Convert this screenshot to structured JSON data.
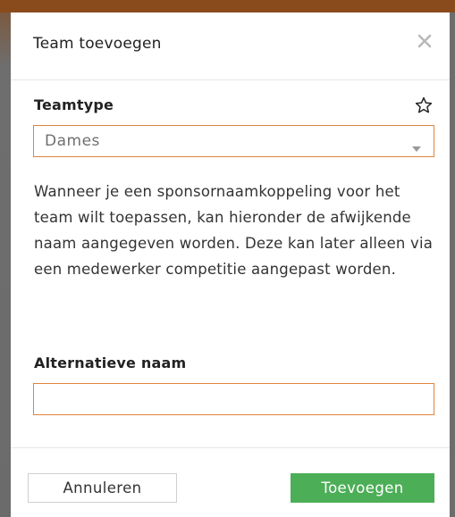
{
  "dialog": {
    "title": "Team toevoegen",
    "close_icon": "close-icon"
  },
  "teamtype": {
    "label": "Teamtype",
    "favorite_icon": "star-icon",
    "selected_value": "Dames",
    "dropdown_icon": "chevron-down-icon"
  },
  "description": "Wanneer je een sponsornaamkoppeling voor het team wilt toepassen, kan hieronder de afwijkende naam aangegeven worden. Deze kan later alleen via een medewerker competitie aangepast worden.",
  "alternative_name": {
    "label": "Alternatieve naam",
    "value": "",
    "placeholder": ""
  },
  "footer": {
    "cancel_label": "Annuleren",
    "submit_label": "Toevoegen"
  },
  "colors": {
    "accent_border": "#e0843a",
    "submit_button": "#4cae57",
    "backdrop": "#6b6b6b"
  }
}
